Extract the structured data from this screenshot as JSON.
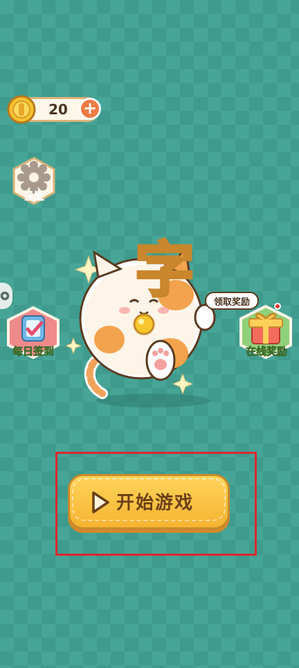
{
  "top_bar": {
    "coin_count": "20",
    "coin_icon": "gold-coin-icon",
    "plus_icon": "plus-icon",
    "plus_symbol": "+"
  },
  "side_menu": {
    "settings_label": "设置",
    "settings_icon": "gear-icon",
    "side_tab_icon": "gear-icon",
    "checkin_label": "每日签到",
    "checkin_icon": "calendar-check-icon"
  },
  "mascot": {
    "title_char": "字",
    "icon": "cat-mascot"
  },
  "reward": {
    "bubble_text": "领取奖励",
    "label": "在线奖励",
    "icon": "gift-box-icon"
  },
  "start": {
    "label": "开始游戏",
    "icon": "play-icon"
  },
  "colors": {
    "background": "#46a597",
    "button": "#f6b32f",
    "highlight": "#e0262f"
  }
}
